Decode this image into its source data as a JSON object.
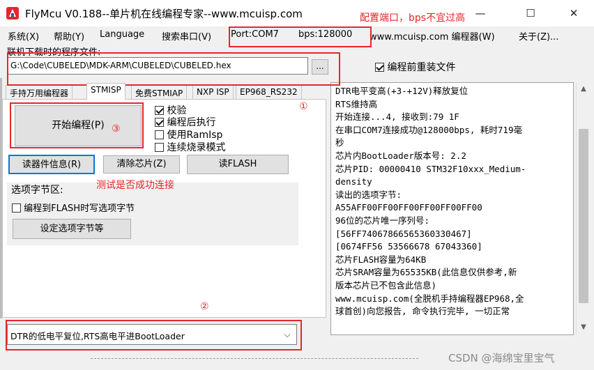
{
  "title": "FlyMcu V0.188--单片机在线编程专家--www.mcuisp.com",
  "title_note": "配置端口，bps不宜过高",
  "window": {
    "min": "—",
    "max": "☐",
    "close": "✕"
  },
  "menu": {
    "system": "系统(X)",
    "help": "帮助(Y)",
    "language": "Language",
    "search_port": "搜索串口(V)",
    "port": "Port:COM7",
    "bps": "bps:128000",
    "site": "www.mcuisp.com 编程器(W)",
    "about": "关于(Z)..."
  },
  "file": {
    "label": "联机下载时的程序文件:",
    "path": "G:\\Code\\CUBELED\\MDK-ARM\\CUBELED\\CUBELED.hex",
    "browse": "...",
    "reload_label": "编程前重装文件",
    "reload_checked": true
  },
  "tabs": [
    "手持万用编程器",
    "STMISP",
    "免费STMIAP",
    "NXP ISP",
    "EP968_RS232"
  ],
  "actions": {
    "start": "开始编程(P)",
    "read_info": "读器件信息(R)",
    "clear_chip": "清除芯片(Z)",
    "read_flash": "读FLASH"
  },
  "options": {
    "verify": "校验",
    "run_after": "编程后执行",
    "use_ramisp": "使用RamIsp",
    "continuous": "连续烧录模式"
  },
  "option_bytes": {
    "title": "选项字节区:",
    "write_label": "编程到FLASH时写选项字节",
    "set_button": "设定选项字节等"
  },
  "annotations": {
    "a1": "①",
    "a2": "②",
    "a3": "③",
    "test_note": "测试是否成功连接"
  },
  "log_lines": [
    "DTR电平变高(+3-+12V)释放复位",
    "RTS维持高",
    "开始连接...4, 接收到:79 1F",
    "在串口COM7连接成功@128000bps, 耗时719毫",
    "秒",
    "芯片内BootLoader版本号: 2.2",
    "芯片PID: 00000410  STM32F10xxx_Medium-",
    "density",
    "读出的选项字节:",
    "A55AFF00FF00FF00FF00FF00FF00",
    "96位的芯片唯一序列号:",
    "[56FF74067866565360330467]",
    "[0674FF56 53566678 67043360]",
    "芯片FLASH容量为64KB",
    "芯片SRAM容量为65535KB(此信息仅供参考,新",
    "版本芯片已不包含此信息)",
    "www.mcuisp.com(全脱机手持编程器EP968,全",
    "球首创)向您报告, 命令执行完毕, 一切正常"
  ],
  "mode_select": "DTR的低电平复位,RTS高电平进BootLoader",
  "watermark": "CSDN @海绵宝里宝气",
  "colors": {
    "annotation": "#e8262a",
    "selection": "#0078d7"
  }
}
